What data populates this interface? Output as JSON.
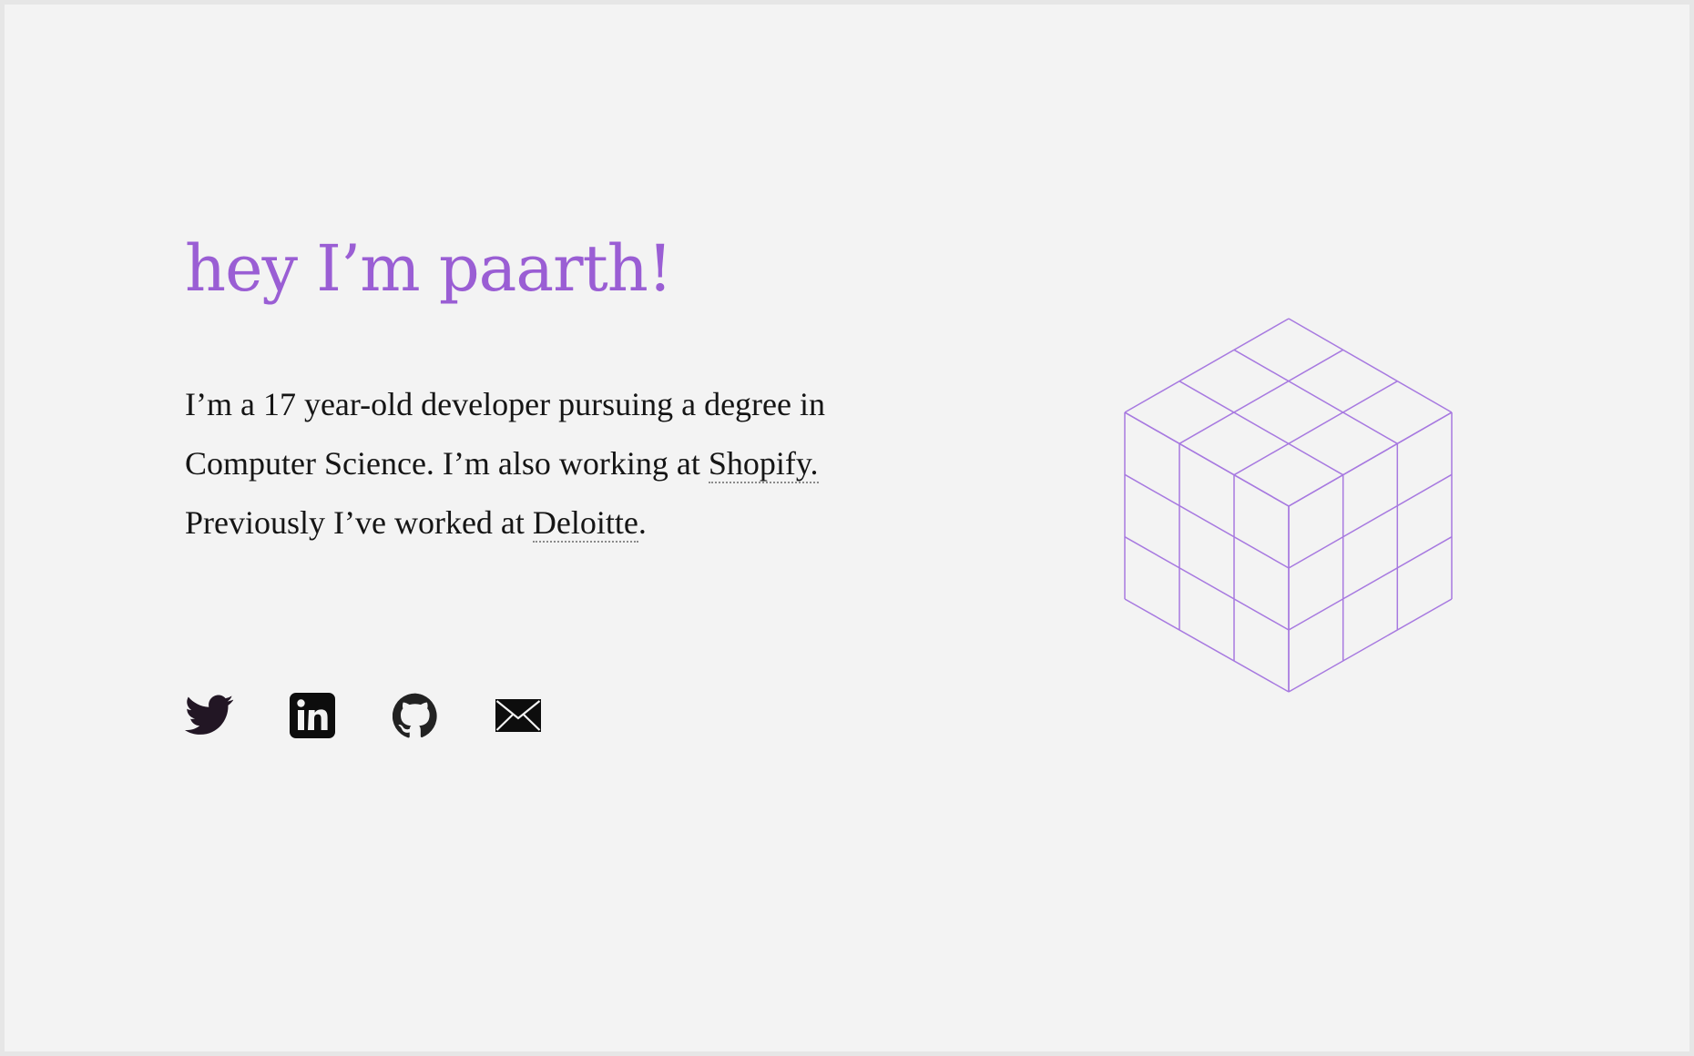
{
  "hero": {
    "title": "hey I’m paarth!",
    "intro_text_1": "I’m a 17 year-old developer pursuing a degree in Computer Science. I’m also working at ",
    "intro_link_shopify": "Shopify.",
    "intro_text_2": " Previously I’ve worked at ",
    "intro_link_deloitte": "Deloitte",
    "intro_text_3": "."
  },
  "socials": [
    {
      "icon": "twitter-icon"
    },
    {
      "icon": "linkedin-icon"
    },
    {
      "icon": "github-icon"
    },
    {
      "icon": "mail-icon"
    }
  ],
  "colors": {
    "accent": "#9a5ed4",
    "cube_stroke": "#a779e0",
    "text": "#151515",
    "background": "#f3f3f3"
  }
}
